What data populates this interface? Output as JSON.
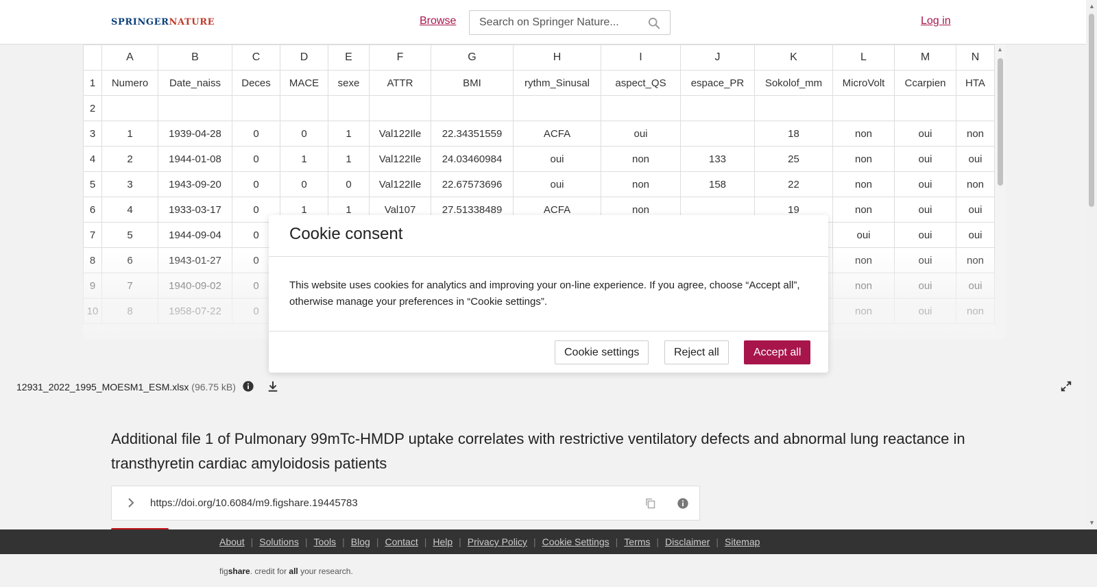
{
  "header": {
    "logo_part1": "SPRINGER",
    "logo_part2": "NATURE",
    "browse_label": "Browse",
    "search_placeholder": "Search on Springer Nature...",
    "login_label": "Log in"
  },
  "spreadsheet": {
    "columns": [
      "A",
      "B",
      "C",
      "D",
      "E",
      "F",
      "G",
      "H",
      "I",
      "J",
      "K",
      "L",
      "M",
      "N"
    ],
    "col_widths": [
      82,
      108,
      70,
      70,
      60,
      90,
      120,
      128,
      116,
      108,
      114,
      90,
      90,
      56
    ],
    "rows": [
      {
        "num": "1",
        "cells": [
          "Numero",
          "Date_naiss",
          "Deces",
          "MACE",
          "sexe",
          "ATTR",
          "BMI",
          "rythm_Sinusal",
          "aspect_QS",
          "espace_PR",
          "Sokolof_mm",
          "MicroVolt",
          "Ccarpien",
          "HTA"
        ]
      },
      {
        "num": "2",
        "cells": [
          "",
          "",
          "",
          "",
          "",
          "",
          "",
          "",
          "",
          "",
          "",
          "",
          "",
          ""
        ]
      },
      {
        "num": "3",
        "cells": [
          "1",
          "1939-04-28",
          "0",
          "0",
          "1",
          "Val122Ile",
          "22.34351559",
          "ACFA",
          "oui",
          "",
          "18",
          "non",
          "oui",
          "non"
        ]
      },
      {
        "num": "4",
        "cells": [
          "2",
          "1944-01-08",
          "0",
          "1",
          "1",
          "Val122Ile",
          "24.03460984",
          "oui",
          "non",
          "133",
          "25",
          "non",
          "oui",
          "oui"
        ]
      },
      {
        "num": "5",
        "cells": [
          "3",
          "1943-09-20",
          "0",
          "0",
          "0",
          "Val122Ile",
          "22.67573696",
          "oui",
          "non",
          "158",
          "22",
          "non",
          "oui",
          "non"
        ]
      },
      {
        "num": "6",
        "cells": [
          "4",
          "1933-03-17",
          "0",
          "1",
          "1",
          "Val107",
          "27.51338489",
          "ACFA",
          "non",
          "",
          "19",
          "non",
          "oui",
          "oui"
        ]
      },
      {
        "num": "7",
        "cells": [
          "5",
          "1944-09-04",
          "0",
          "",
          "",
          "",
          "",
          "",
          "",
          "",
          "",
          "oui",
          "oui",
          "oui"
        ]
      },
      {
        "num": "8",
        "cells": [
          "6",
          "1943-01-27",
          "0",
          "",
          "",
          "",
          "",
          "",
          "",
          "",
          "",
          "non",
          "oui",
          "non"
        ]
      },
      {
        "num": "9",
        "cells": [
          "7",
          "1940-09-02",
          "0",
          "",
          "",
          "",
          "",
          "",
          "",
          "",
          "",
          "non",
          "oui",
          "oui"
        ]
      },
      {
        "num": "10",
        "cells": [
          "8",
          "1958-07-22",
          "0",
          "",
          "",
          "",
          "",
          "",
          "",
          "",
          "",
          "non",
          "oui",
          "non"
        ]
      }
    ]
  },
  "file": {
    "name": "12931_2022_1995_MOESM1_ESM.xlsx",
    "size": "(96.75 kB)"
  },
  "content": {
    "title": "Additional file 1 of Pulmonary 99mTc-HMDP uptake correlates with restrictive ventilatory defects and abnormal lung reactance in transthyretin cardiac amyloidosis patients",
    "doi": "https://doi.org/10.6084/m9.figshare.19445783"
  },
  "footer": {
    "links": [
      "About",
      "Solutions",
      "Tools",
      "Blog",
      "Contact",
      "Help",
      "Privacy Policy",
      "Cookie Settings",
      "Terms",
      "Disclaimer",
      "Sitemap"
    ],
    "brand_fig": "fig",
    "brand_share": "share",
    "brand_text1": ". credit for ",
    "brand_all": "all",
    "brand_text2": " your research."
  },
  "cookie_modal": {
    "title": "Cookie consent",
    "body": "This website uses cookies for analytics and improving your on-line experience. If you agree, choose “Accept all”, otherwise manage your preferences in “Cookie settings”.",
    "settings_label": "Cookie settings",
    "reject_label": "Reject all",
    "accept_label": "Accept all"
  },
  "colors": {
    "brand": "#a8154b",
    "footer_bg": "#333333"
  },
  "icons": {
    "search": "search-icon",
    "info": "info-icon",
    "download": "download-icon",
    "expand": "expand-icon",
    "chevron": "chevron-right-icon",
    "copy": "copy-icon"
  }
}
